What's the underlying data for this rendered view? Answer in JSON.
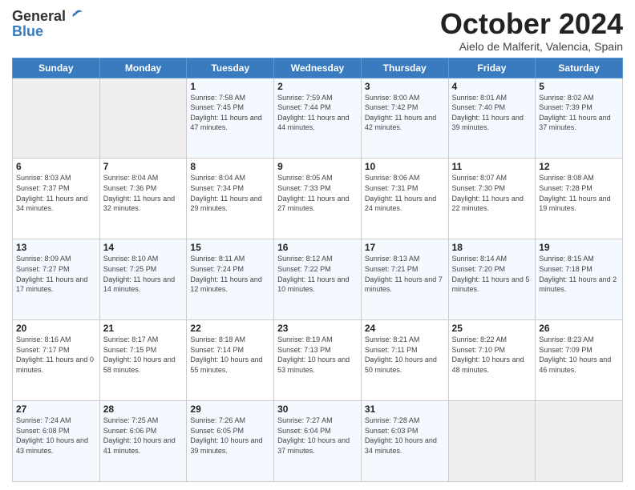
{
  "header": {
    "logo_general": "General",
    "logo_blue": "Blue",
    "month_title": "October 2024",
    "location": "Aielo de Malferit, Valencia, Spain"
  },
  "days_of_week": [
    "Sunday",
    "Monday",
    "Tuesday",
    "Wednesday",
    "Thursday",
    "Friday",
    "Saturday"
  ],
  "weeks": [
    [
      {
        "day": "",
        "sunrise": "",
        "sunset": "",
        "daylight": "",
        "empty": true
      },
      {
        "day": "",
        "sunrise": "",
        "sunset": "",
        "daylight": "",
        "empty": true
      },
      {
        "day": "1",
        "sunrise": "Sunrise: 7:58 AM",
        "sunset": "Sunset: 7:45 PM",
        "daylight": "Daylight: 11 hours and 47 minutes.",
        "empty": false
      },
      {
        "day": "2",
        "sunrise": "Sunrise: 7:59 AM",
        "sunset": "Sunset: 7:44 PM",
        "daylight": "Daylight: 11 hours and 44 minutes.",
        "empty": false
      },
      {
        "day": "3",
        "sunrise": "Sunrise: 8:00 AM",
        "sunset": "Sunset: 7:42 PM",
        "daylight": "Daylight: 11 hours and 42 minutes.",
        "empty": false
      },
      {
        "day": "4",
        "sunrise": "Sunrise: 8:01 AM",
        "sunset": "Sunset: 7:40 PM",
        "daylight": "Daylight: 11 hours and 39 minutes.",
        "empty": false
      },
      {
        "day": "5",
        "sunrise": "Sunrise: 8:02 AM",
        "sunset": "Sunset: 7:39 PM",
        "daylight": "Daylight: 11 hours and 37 minutes.",
        "empty": false
      }
    ],
    [
      {
        "day": "6",
        "sunrise": "Sunrise: 8:03 AM",
        "sunset": "Sunset: 7:37 PM",
        "daylight": "Daylight: 11 hours and 34 minutes.",
        "empty": false
      },
      {
        "day": "7",
        "sunrise": "Sunrise: 8:04 AM",
        "sunset": "Sunset: 7:36 PM",
        "daylight": "Daylight: 11 hours and 32 minutes.",
        "empty": false
      },
      {
        "day": "8",
        "sunrise": "Sunrise: 8:04 AM",
        "sunset": "Sunset: 7:34 PM",
        "daylight": "Daylight: 11 hours and 29 minutes.",
        "empty": false
      },
      {
        "day": "9",
        "sunrise": "Sunrise: 8:05 AM",
        "sunset": "Sunset: 7:33 PM",
        "daylight": "Daylight: 11 hours and 27 minutes.",
        "empty": false
      },
      {
        "day": "10",
        "sunrise": "Sunrise: 8:06 AM",
        "sunset": "Sunset: 7:31 PM",
        "daylight": "Daylight: 11 hours and 24 minutes.",
        "empty": false
      },
      {
        "day": "11",
        "sunrise": "Sunrise: 8:07 AM",
        "sunset": "Sunset: 7:30 PM",
        "daylight": "Daylight: 11 hours and 22 minutes.",
        "empty": false
      },
      {
        "day": "12",
        "sunrise": "Sunrise: 8:08 AM",
        "sunset": "Sunset: 7:28 PM",
        "daylight": "Daylight: 11 hours and 19 minutes.",
        "empty": false
      }
    ],
    [
      {
        "day": "13",
        "sunrise": "Sunrise: 8:09 AM",
        "sunset": "Sunset: 7:27 PM",
        "daylight": "Daylight: 11 hours and 17 minutes.",
        "empty": false
      },
      {
        "day": "14",
        "sunrise": "Sunrise: 8:10 AM",
        "sunset": "Sunset: 7:25 PM",
        "daylight": "Daylight: 11 hours and 14 minutes.",
        "empty": false
      },
      {
        "day": "15",
        "sunrise": "Sunrise: 8:11 AM",
        "sunset": "Sunset: 7:24 PM",
        "daylight": "Daylight: 11 hours and 12 minutes.",
        "empty": false
      },
      {
        "day": "16",
        "sunrise": "Sunrise: 8:12 AM",
        "sunset": "Sunset: 7:22 PM",
        "daylight": "Daylight: 11 hours and 10 minutes.",
        "empty": false
      },
      {
        "day": "17",
        "sunrise": "Sunrise: 8:13 AM",
        "sunset": "Sunset: 7:21 PM",
        "daylight": "Daylight: 11 hours and 7 minutes.",
        "empty": false
      },
      {
        "day": "18",
        "sunrise": "Sunrise: 8:14 AM",
        "sunset": "Sunset: 7:20 PM",
        "daylight": "Daylight: 11 hours and 5 minutes.",
        "empty": false
      },
      {
        "day": "19",
        "sunrise": "Sunrise: 8:15 AM",
        "sunset": "Sunset: 7:18 PM",
        "daylight": "Daylight: 11 hours and 2 minutes.",
        "empty": false
      }
    ],
    [
      {
        "day": "20",
        "sunrise": "Sunrise: 8:16 AM",
        "sunset": "Sunset: 7:17 PM",
        "daylight": "Daylight: 11 hours and 0 minutes.",
        "empty": false
      },
      {
        "day": "21",
        "sunrise": "Sunrise: 8:17 AM",
        "sunset": "Sunset: 7:15 PM",
        "daylight": "Daylight: 10 hours and 58 minutes.",
        "empty": false
      },
      {
        "day": "22",
        "sunrise": "Sunrise: 8:18 AM",
        "sunset": "Sunset: 7:14 PM",
        "daylight": "Daylight: 10 hours and 55 minutes.",
        "empty": false
      },
      {
        "day": "23",
        "sunrise": "Sunrise: 8:19 AM",
        "sunset": "Sunset: 7:13 PM",
        "daylight": "Daylight: 10 hours and 53 minutes.",
        "empty": false
      },
      {
        "day": "24",
        "sunrise": "Sunrise: 8:21 AM",
        "sunset": "Sunset: 7:11 PM",
        "daylight": "Daylight: 10 hours and 50 minutes.",
        "empty": false
      },
      {
        "day": "25",
        "sunrise": "Sunrise: 8:22 AM",
        "sunset": "Sunset: 7:10 PM",
        "daylight": "Daylight: 10 hours and 48 minutes.",
        "empty": false
      },
      {
        "day": "26",
        "sunrise": "Sunrise: 8:23 AM",
        "sunset": "Sunset: 7:09 PM",
        "daylight": "Daylight: 10 hours and 46 minutes.",
        "empty": false
      }
    ],
    [
      {
        "day": "27",
        "sunrise": "Sunrise: 7:24 AM",
        "sunset": "Sunset: 6:08 PM",
        "daylight": "Daylight: 10 hours and 43 minutes.",
        "empty": false
      },
      {
        "day": "28",
        "sunrise": "Sunrise: 7:25 AM",
        "sunset": "Sunset: 6:06 PM",
        "daylight": "Daylight: 10 hours and 41 minutes.",
        "empty": false
      },
      {
        "day": "29",
        "sunrise": "Sunrise: 7:26 AM",
        "sunset": "Sunset: 6:05 PM",
        "daylight": "Daylight: 10 hours and 39 minutes.",
        "empty": false
      },
      {
        "day": "30",
        "sunrise": "Sunrise: 7:27 AM",
        "sunset": "Sunset: 6:04 PM",
        "daylight": "Daylight: 10 hours and 37 minutes.",
        "empty": false
      },
      {
        "day": "31",
        "sunrise": "Sunrise: 7:28 AM",
        "sunset": "Sunset: 6:03 PM",
        "daylight": "Daylight: 10 hours and 34 minutes.",
        "empty": false
      },
      {
        "day": "",
        "sunrise": "",
        "sunset": "",
        "daylight": "",
        "empty": true
      },
      {
        "day": "",
        "sunrise": "",
        "sunset": "",
        "daylight": "",
        "empty": true
      }
    ]
  ]
}
